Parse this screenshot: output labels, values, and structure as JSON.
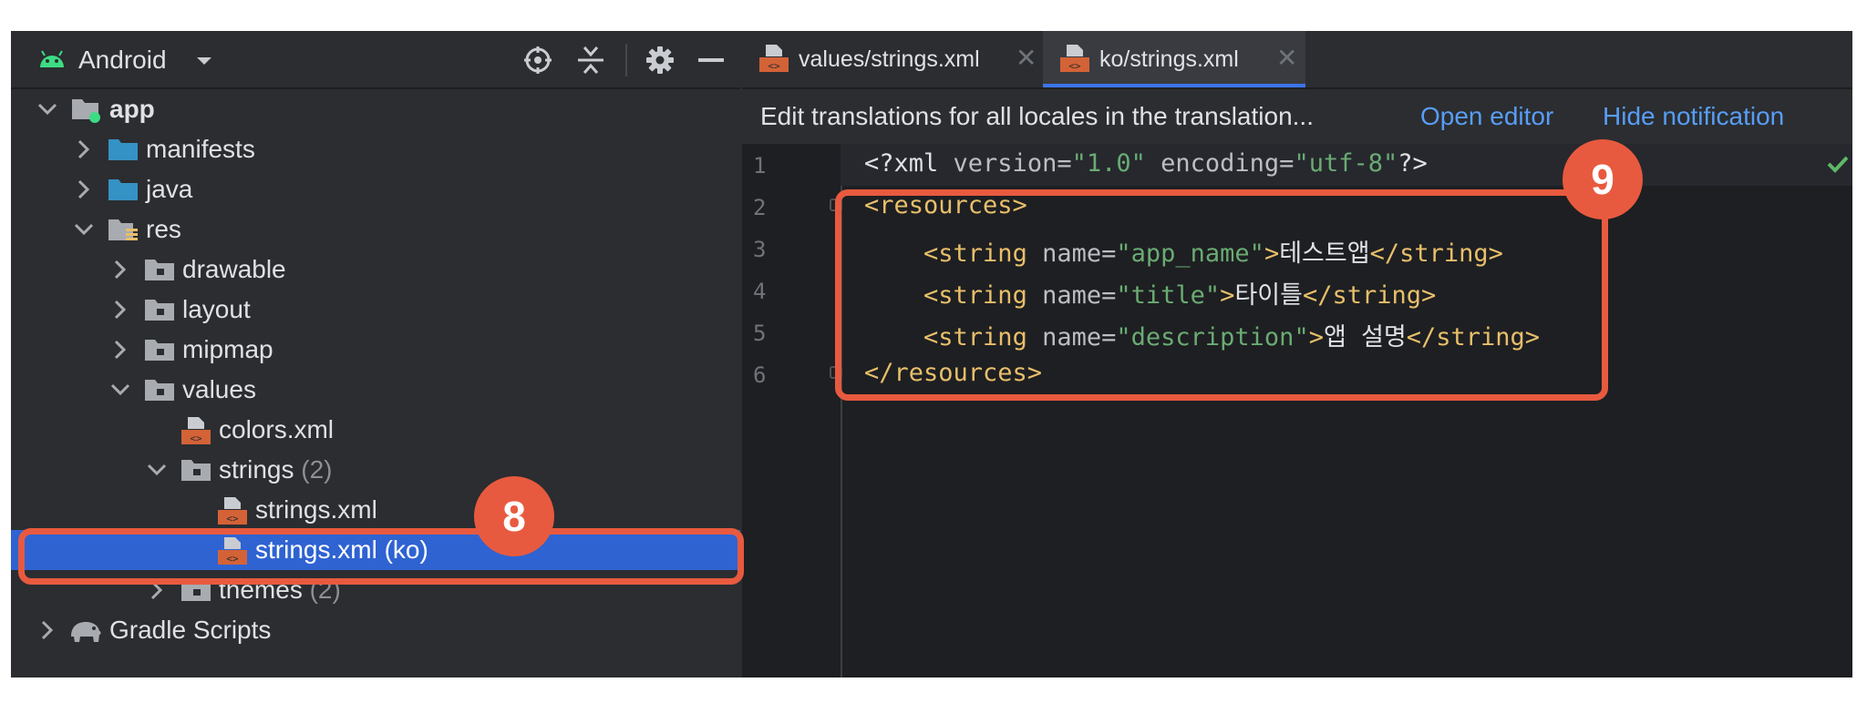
{
  "project_panel": {
    "view_label": "Android",
    "toolbar_icons": [
      "locate-icon",
      "collapse-all-icon",
      "gear-icon",
      "minimize-icon"
    ],
    "tree": [
      {
        "label": "app",
        "bold": true
      },
      {
        "label": "manifests"
      },
      {
        "label": "java"
      },
      {
        "label": "res"
      },
      {
        "label": "drawable"
      },
      {
        "label": "layout"
      },
      {
        "label": "mipmap"
      },
      {
        "label": "values"
      },
      {
        "label": "colors.xml"
      },
      {
        "label": "strings",
        "count": "(2)"
      },
      {
        "label": "strings.xml"
      },
      {
        "label": "strings.xml (ko)",
        "selected": true
      },
      {
        "label": "themes",
        "count": "(2)"
      },
      {
        "label": "Gradle Scripts"
      }
    ]
  },
  "editor": {
    "tabs": [
      {
        "label": "values/strings.xml",
        "active": false
      },
      {
        "label": "ko/strings.xml",
        "active": true
      }
    ],
    "notification": {
      "text": "Edit translations for all locales in the translation...",
      "open_editor": "Open editor",
      "hide": "Hide notification"
    },
    "line_numbers": [
      "1",
      "2",
      "3",
      "4",
      "5",
      "6"
    ],
    "code": {
      "l1_open": "<?xml",
      "l1_version_attr": " version=",
      "l1_version_val": "\"1.0\"",
      "l1_encoding_attr": " encoding=",
      "l1_encoding_val": "\"utf-8\"",
      "l1_close": "?>",
      "l2": "<resources>",
      "string_open": "<string",
      "name_attr": " name=",
      "string_close": "</string>",
      "l3_name": "\"app_name\"",
      "l3_text": "테스트앱",
      "l4_name": "\"title\"",
      "l4_text": "타이틀",
      "l5_name": "\"description\"",
      "l5_text": "앱 설명",
      "l6": "</resources>"
    }
  },
  "annotations": {
    "badge_8": "8",
    "badge_9": "9"
  },
  "colors": {
    "selection": "#2f63d2",
    "callout": "#e85a3f",
    "link": "#589df6",
    "tag": "#e8bf6a",
    "string": "#6aab73"
  }
}
